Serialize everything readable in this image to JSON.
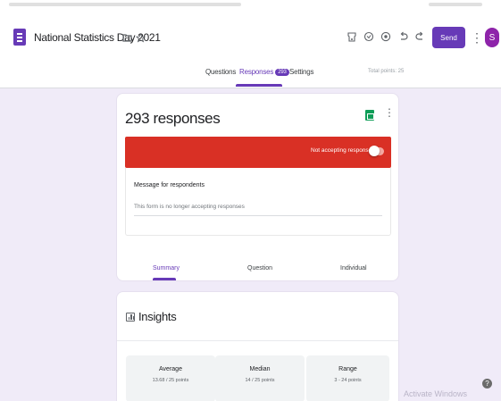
{
  "header": {
    "title": "National Statistics Day 2021",
    "icons": [
      "forms-logo-icon",
      "folder-icon",
      "star-icon",
      "palette-icon",
      "preview-icon",
      "addon-icon",
      "undo-icon",
      "redo-icon",
      "more-vert-icon"
    ],
    "send_label": "Send",
    "avatar_letter": "S"
  },
  "tabs": {
    "questions": "Questions",
    "responses": "Responses",
    "responses_count": "293",
    "settings": "Settings",
    "total_points": "Total points: 25"
  },
  "responses": {
    "count_label": "293 responses",
    "accepting_label": "Not accepting responses",
    "accepting": false,
    "message_label": "Message for respondents",
    "message_text": "This form is no longer accepting responses"
  },
  "view_tabs": {
    "summary": "Summary",
    "question": "Question",
    "individual": "Individual",
    "selected": "Summary"
  },
  "insights": {
    "title": "Insights",
    "stats": [
      {
        "label": "Average",
        "value": "13.68 / 25 points"
      },
      {
        "label": "Median",
        "value": "14 / 25 points"
      },
      {
        "label": "Range",
        "value": "3 - 24 points"
      }
    ]
  },
  "overlay": {
    "watermark": "Activate Windows"
  },
  "colors": {
    "accent": "#673ab7",
    "banner": "#d93025",
    "background": "#f0ebf8"
  }
}
